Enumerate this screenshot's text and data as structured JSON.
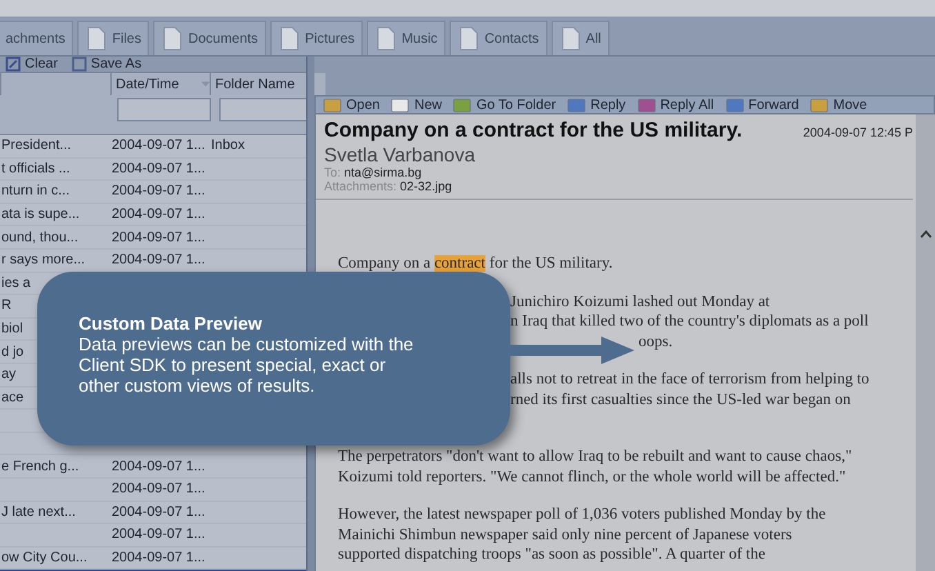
{
  "tabs": [
    {
      "label": "achments",
      "selected": false,
      "icon": false
    },
    {
      "label": "Files",
      "selected": false,
      "icon": true
    },
    {
      "label": "Documents",
      "selected": false,
      "icon": true
    },
    {
      "label": "Pictures",
      "selected": false,
      "icon": true
    },
    {
      "label": "Music",
      "selected": false,
      "icon": true
    },
    {
      "label": "Contacts",
      "selected": false,
      "icon": true
    },
    {
      "label": "All",
      "selected": false,
      "icon": true
    }
  ],
  "list_toolbar": [
    {
      "kind": "clear",
      "label": "Clear"
    },
    {
      "kind": "save",
      "label": "Save As"
    }
  ],
  "table": {
    "columns": [
      {
        "label": "Date/Time",
        "sortable": true
      },
      {
        "label": "Folder Name"
      }
    ],
    "rows": [
      {
        "subject": "President...",
        "date": "2004-09-07 1...",
        "folder": "Inbox",
        "selected": false
      },
      {
        "subject": "t officials ...",
        "date": "2004-09-07 1...",
        "selected": false
      },
      {
        "subject": "nturn in c...",
        "date": "2004-09-07 1...",
        "selected": false
      },
      {
        "subject": "ata is supe...",
        "date": "2004-09-07 1...",
        "selected": false
      },
      {
        "subject": "ound, thou...",
        "date": "2004-09-07 1...",
        "selected": false
      },
      {
        "subject": "r says more...",
        "date": "2004-09-07 1...",
        "selected": false
      },
      {
        "subject": "ies a",
        "selected": false
      },
      {
        "subject": "R",
        "selected": false
      },
      {
        "subject": "biol",
        "selected": false
      },
      {
        "subject": "d jo",
        "selected": false
      },
      {
        "subject": "ay",
        "selected": false
      },
      {
        "subject": "ace",
        "selected": false
      },
      {
        "selected": false
      },
      {
        "selected": false
      },
      {
        "subject": "e French g...",
        "date": "2004-09-07 1...",
        "selected": false
      },
      {
        "date": "2004-09-07 1...",
        "selected": false
      },
      {
        "subject": "J late next...",
        "date": "2004-09-07 1...",
        "selected": false
      },
      {
        "date": "2004-09-07 1...",
        "selected": false
      },
      {
        "subject": "ow City Cou...",
        "date": "2004-09-07 1...",
        "selected": false
      },
      {
        "selected": true
      }
    ]
  },
  "message_toolbar": [
    {
      "kind": "open",
      "label": "Open"
    },
    {
      "kind": "new",
      "label": "New"
    },
    {
      "kind": "folder",
      "label": "Go To Folder"
    },
    {
      "kind": "reply",
      "label": "Reply"
    },
    {
      "kind": "replyall",
      "label": "Reply All"
    },
    {
      "kind": "forward",
      "label": "Forward"
    },
    {
      "kind": "move",
      "label": "Move"
    }
  ],
  "message": {
    "subject": "Company on a contract for the US military.",
    "date": "2004-09-07 12:45 P",
    "sender": "Svetla Varbanova",
    "to_label": "To:",
    "to": "nta@sirma.bg",
    "attachments_label": "Attachments:",
    "attachments": "02-32.jpg",
    "paragraphs": [
      {
        "lines": [
          {
            "kind": "full",
            "parts": [
              {
                "text": "Company on a ",
                "highlighted": false
              },
              {
                "text": "contract",
                "highlighted": true
              },
              {
                "text": " for the US military.",
                "highlighted": false
              }
            ]
          }
        ]
      },
      {
        "lines": [
          {
            "kind": "cut",
            "parts": [
              {
                "text": "Junichiro Koizumi lashed out Monday at",
                "highlighted": false
              }
            ]
          },
          {
            "kind": "cut",
            "parts": [
              {
                "text": "n Iraq that killed two of the country's diplomats as a poll",
                "highlighted": false
              }
            ]
          },
          {
            "kind": "tail",
            "parts": [
              {
                "text": "oops.",
                "highlighted": false
              }
            ]
          }
        ]
      },
      {
        "lines": [
          {
            "kind": "cut",
            "parts": [
              {
                "text": "alls not to retreat in the face of terrorism from helping to",
                "highlighted": false
              }
            ]
          },
          {
            "kind": "cut",
            "parts": [
              {
                "text": "rned its first casualties since the US-led war began on",
                "highlighted": false
              }
            ]
          }
        ]
      },
      {
        "lines": [
          {
            "kind": "full",
            "parts": [
              {
                "text": "The perpetrators \"don't want to allow Iraq to be rebuilt and want to cause chaos,\"",
                "highlighted": false
              }
            ]
          },
          {
            "kind": "full",
            "parts": [
              {
                "text": "Koizumi told reporters. \"We cannot flinch, or the whole world will be affected.\"",
                "highlighted": false
              }
            ]
          }
        ]
      },
      {
        "lines": [
          {
            "kind": "full",
            "parts": [
              {
                "text": "However, the latest newspaper poll of 1,036 voters published Monday by the",
                "highlighted": false
              }
            ]
          },
          {
            "kind": "full",
            "parts": [
              {
                "text": "Mainichi Shimbun newspaper said only nine percent of Japanese voters",
                "highlighted": false
              }
            ]
          },
          {
            "kind": "full",
            "parts": [
              {
                "text": "supported dispatching troops \"as soon as possible\". A quarter of the",
                "highlighted": false
              }
            ]
          }
        ]
      }
    ]
  },
  "callout": {
    "title": "Custom Data Preview",
    "text": "Data previews can be customized with the Client SDK to present special, exact or other custom views of results."
  }
}
